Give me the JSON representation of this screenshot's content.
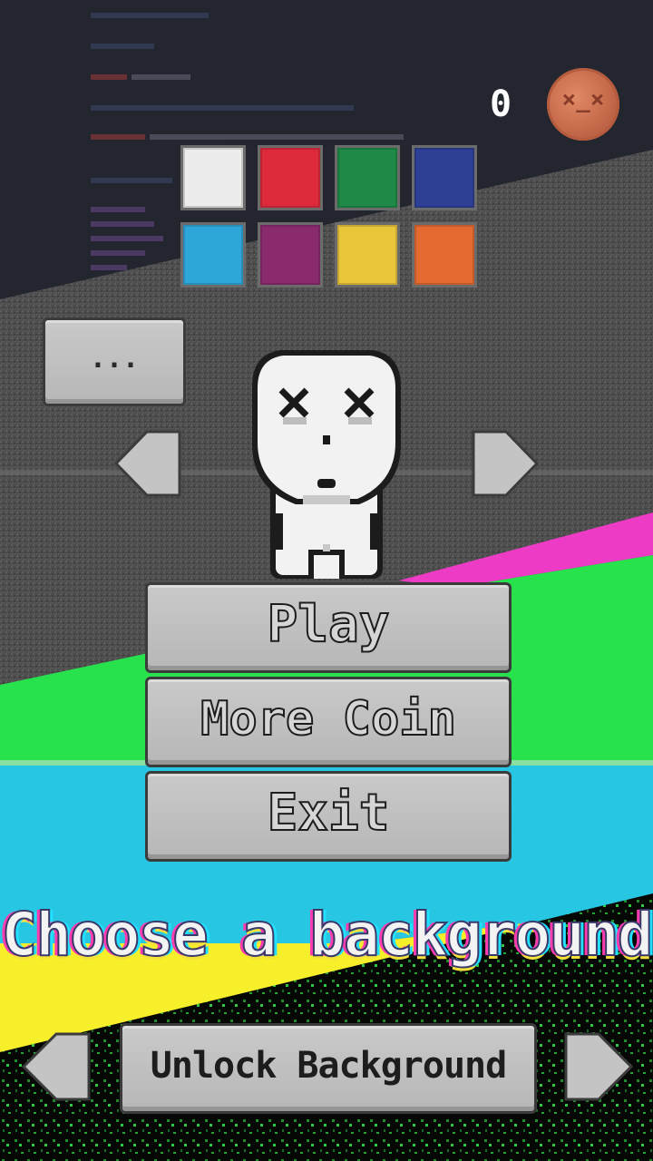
{
  "coins": {
    "count": "0",
    "icon": "coin-icon",
    "face": "×_×"
  },
  "swatches": [
    {
      "name": "white",
      "color": "#ececec"
    },
    {
      "name": "red",
      "color": "#de2b3c"
    },
    {
      "name": "green",
      "color": "#1f8a47"
    },
    {
      "name": "blue",
      "color": "#2e3f96"
    },
    {
      "name": "light-blue",
      "color": "#2fa6da"
    },
    {
      "name": "purple",
      "color": "#8a2b6e"
    },
    {
      "name": "yellow",
      "color": "#e9c53a"
    },
    {
      "name": "orange",
      "color": "#e56a32"
    }
  ],
  "options_button": {
    "label": "..."
  },
  "character": {
    "icon": "skull-character-icon",
    "nav_left": "arrow-left-icon",
    "nav_right": "arrow-right-icon"
  },
  "menu": {
    "play": "Play",
    "more_coin": "More Coin",
    "exit": "Exit"
  },
  "background_picker": {
    "title": "Choose a background",
    "unlock_label": "Unlock Background",
    "nav_left": "arrow-left-icon",
    "nav_right": "arrow-right-icon"
  },
  "colors": {
    "button_fill": "#bdbdbd",
    "button_border": "#3b3b3b",
    "stripe_green": "#27e24d",
    "stripe_cyan": "#27c7e4",
    "stripe_magenta": "#ee3bc6",
    "stripe_yellow": "#f6ef2a"
  }
}
